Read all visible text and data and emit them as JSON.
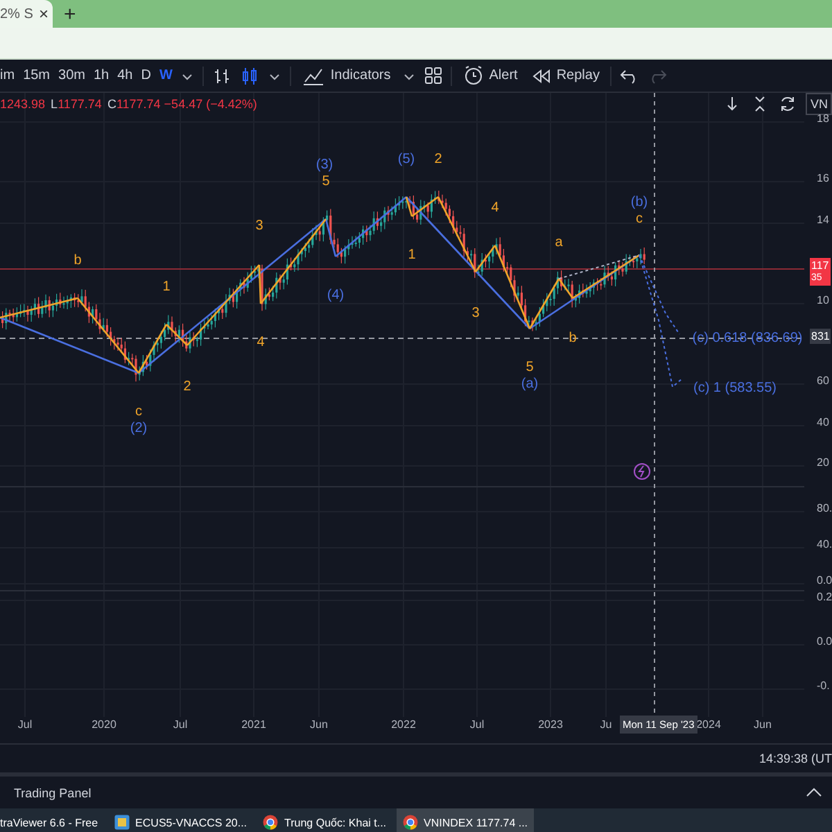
{
  "browser": {
    "tab": {
      "title": "2% S",
      "selected": true
    },
    "close": "×",
    "new_tab": "+"
  },
  "toolbar": {
    "intervals": [
      {
        "label": "im",
        "selected": false
      },
      {
        "label": "15m",
        "selected": false
      },
      {
        "label": "30m",
        "selected": false
      },
      {
        "label": "1h",
        "selected": false
      },
      {
        "label": "4h",
        "selected": false
      },
      {
        "label": "D",
        "selected": false
      },
      {
        "label": "W",
        "selected": true
      }
    ],
    "indicators": "Indicators",
    "alert": "Alert",
    "replay": "Replay"
  },
  "legend": {
    "items": [
      {
        "value": "1243.98"
      },
      {
        "key": "L",
        "value": "1177.74"
      },
      {
        "key": "C",
        "value": "1177.74 −54.47 (−4.42%)"
      }
    ],
    "symbol": "VN"
  },
  "chart": {
    "wave_labels": [
      {
        "text": "b",
        "color": "#f0a429"
      },
      {
        "text": "1",
        "color": "#f0a429"
      },
      {
        "text": "2",
        "color": "#f0a429"
      },
      {
        "text": "c",
        "color": "#f0a429"
      },
      {
        "text": "(2)",
        "color": "#4a6fe0"
      },
      {
        "text": "3",
        "color": "#f0a429"
      },
      {
        "text": "4",
        "color": "#f0a429"
      },
      {
        "text": "(3)",
        "color": "#4a6fe0"
      },
      {
        "text": "5",
        "color": "#f0a429"
      },
      {
        "text": "(4)",
        "color": "#4a6fe0"
      },
      {
        "text": "(5)",
        "color": "#4a6fe0"
      },
      {
        "text": "2",
        "color": "#f0a429"
      },
      {
        "text": "1",
        "color": "#f0a429"
      },
      {
        "text": "4",
        "color": "#f0a429"
      },
      {
        "text": "3",
        "color": "#f0a429"
      },
      {
        "text": "a",
        "color": "#f0a429"
      },
      {
        "text": "b",
        "color": "#f0a429"
      },
      {
        "text": "5",
        "color": "#f0a429"
      },
      {
        "text": "(a)",
        "color": "#4a6fe0"
      },
      {
        "text": "(b)",
        "color": "#4a6fe0"
      },
      {
        "text": "c",
        "color": "#f0a429"
      },
      {
        "text": "(c) 0.618 (836.69)",
        "color": "#4a6fe0"
      },
      {
        "text": "(c) 1 (583.55)",
        "color": "#4a6fe0"
      }
    ],
    "price_axis": [
      "18",
      "16",
      "14",
      "10",
      "60",
      "40",
      "20",
      "80.",
      "40.",
      "0.0",
      "0.2",
      "0.0",
      "-0."
    ],
    "last_price": {
      "value": "117",
      "sub": "35"
    },
    "level_price": "831",
    "time_axis": [
      "Jul",
      "2020",
      "Jul",
      "2021",
      "Jun",
      "2022",
      "Jul",
      "2023",
      "Ju",
      "2024",
      "Jun"
    ],
    "crosshair_date": "Mon 11 Sep '23"
  },
  "status": {
    "time": "14:39:38 (UT"
  },
  "panel": {
    "title": "Trading Panel"
  },
  "taskbar": [
    {
      "label": "traViewer 6.6 - Free",
      "kind": "plain",
      "active": false
    },
    {
      "label": "ECUS5-VNACCS 20...",
      "kind": "app",
      "active": false
    },
    {
      "label": "Trung Quốc: Khai t...",
      "kind": "browser",
      "active": false
    },
    {
      "label": "VNINDEX 1177.74 ...",
      "kind": "browser",
      "active": true
    }
  ]
}
